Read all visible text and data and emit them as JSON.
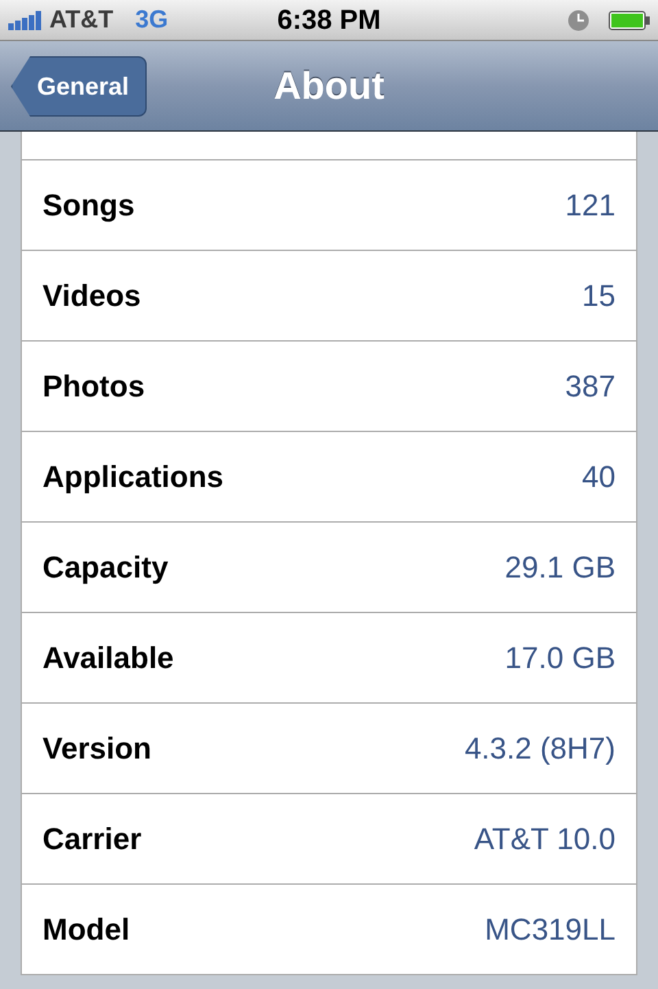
{
  "status_bar": {
    "carrier": "AT&T",
    "network": "3G",
    "time": "6:38 PM"
  },
  "nav_bar": {
    "back_button": "General",
    "title": "About"
  },
  "rows": [
    {
      "label": "Songs",
      "value": "121"
    },
    {
      "label": "Videos",
      "value": "15"
    },
    {
      "label": "Photos",
      "value": "387"
    },
    {
      "label": "Applications",
      "value": "40"
    },
    {
      "label": "Capacity",
      "value": "29.1 GB"
    },
    {
      "label": "Available",
      "value": "17.0 GB"
    },
    {
      "label": "Version",
      "value": "4.3.2 (8H7)"
    },
    {
      "label": "Carrier",
      "value": "AT&T 10.0"
    },
    {
      "label": "Model",
      "value": "MC319LL"
    }
  ]
}
